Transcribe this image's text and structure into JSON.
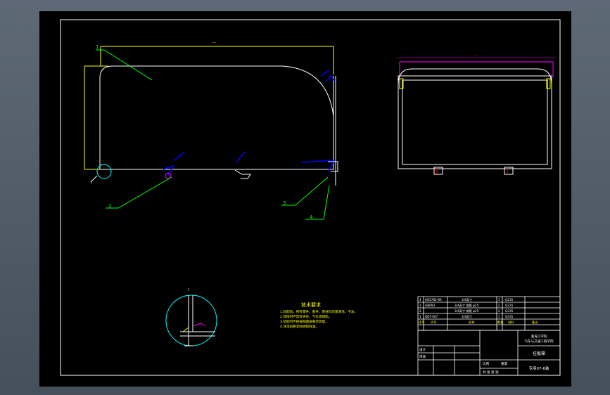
{
  "drawing": {
    "part_labels": [
      "1",
      "2",
      "3",
      "4"
    ],
    "detail_marker": "7"
  },
  "tech_req": {
    "title": "技术要求",
    "lines": [
      "1.装配前，所有零件、部件、原材料均须清洗、干净。",
      "2.焊接时严禁有夹杂、气孔等缺陷。",
      "3.装配时严格按照图纸要求装配。",
      "4.涂漆前要求除锈和除油。"
    ]
  },
  "bom": {
    "rows": [
      {
        "no": "4",
        "code": "GB5782-86",
        "name": "",
        "spec": "3/4英寸",
        "qty": "1",
        "material": "Q235",
        "remark": ""
      },
      {
        "no": "3",
        "code": "GB893",
        "name": "",
        "spec": "3/4英寸 钢管 φ25",
        "qty": "2",
        "material": "Q235",
        "remark": ""
      },
      {
        "no": "2",
        "code": "",
        "name": "",
        "spec": "3/4英寸 钢管 φ25",
        "qty": "2",
        "material": "Q235",
        "remark": ""
      },
      {
        "no": "1",
        "code": "QDT-007",
        "name": "",
        "spec": "3/4英寸",
        "qty": "1",
        "material": "Q235",
        "remark": ""
      }
    ],
    "header": [
      "序号",
      "代号",
      "名称",
      "数量",
      "材料",
      "备注"
    ]
  },
  "title_block": {
    "school": "淮海工学院",
    "dept": "汽车与交通工程学院",
    "part_name": "挂板箱",
    "drawing_no": "专用07-6装",
    "designer_label": "设计",
    "checker_label": "审核",
    "scale_label": "比例",
    "weight_label": "重量",
    "sheet_label": "共 张 第 张"
  },
  "colors": {
    "outline": "#ffffff",
    "dimension": "#ffff00",
    "leader": "#00ff00",
    "detail": "#00ffff",
    "weld": "#0000ff",
    "magenta": "#ff00ff",
    "red": "#ff0000"
  }
}
